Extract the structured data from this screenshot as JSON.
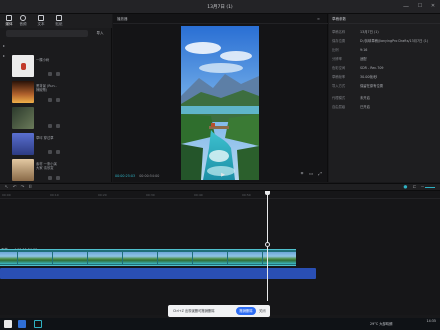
{
  "window": {
    "title": "13月7日 (1)",
    "minimize": "—",
    "maximize": "☐",
    "close": "✕"
  },
  "toolbar": {
    "tools": [
      {
        "label": "媒体",
        "icon": "media-icon"
      },
      {
        "label": "音频",
        "icon": "audio-icon"
      },
      {
        "label": "文本",
        "icon": "text-icon"
      },
      {
        "label": "贴纸",
        "icon": "sticker-icon"
      }
    ]
  },
  "media": {
    "import_label": "导入",
    "items": [
      {
        "caption": "一棵小树",
        "meta": "",
        "color": "#e9e9e9"
      },
      {
        "caption": "黑背景 (Run..辣椒歌)",
        "meta": "",
        "color": "#8a4b2a"
      },
      {
        "caption": "",
        "meta": "",
        "color": "#3a4a3a"
      },
      {
        "caption": "草坪 穿过草",
        "meta": "",
        "color": "#4a5aa8"
      },
      {
        "caption": "素材 一条小溪 大家 请欣赏",
        "meta": "",
        "color": "#c49a6a"
      }
    ]
  },
  "player": {
    "header": "播放器",
    "current_time": "00:00:25:03",
    "total_time": "00:00:54:00",
    "play_icon": "▶"
  },
  "properties": {
    "header": "草稿参数",
    "rows": [
      {
        "key": "草稿名称",
        "value": "13月7日 (1)"
      },
      {
        "key": "保存位置",
        "value": "D:/剪映草稿/JianyingPro Drafts/13月7日 (1)"
      },
      {
        "key": "比例",
        "value": "9:16"
      },
      {
        "key": "分辨率",
        "value": "适配"
      },
      {
        "key": "色彩空间",
        "value": "SDR - Rec.709"
      },
      {
        "key": "草稿帧率",
        "value": "30.00帧/秒"
      },
      {
        "key": "导入方式",
        "value": "保留在原有位置"
      },
      {
        "key": "代理模式",
        "value": "未开启"
      },
      {
        "key": "自由层级",
        "value": "已开启"
      }
    ]
  },
  "timeline": {
    "ruler_labels": [
      "00:00",
      "00:10",
      "00:20",
      "00:30",
      "00:40",
      "00:50"
    ],
    "clip_label": "素材.mp4 00:00:54:00"
  },
  "toast": {
    "text": "Ctrl+Z 出现误删可撤销删除",
    "button": "撤销删除",
    "close": "关闭"
  },
  "taskbar": {
    "tray_text": "29°C 大部晴朗",
    "time": "14:35",
    "date": "2024/1/8"
  }
}
